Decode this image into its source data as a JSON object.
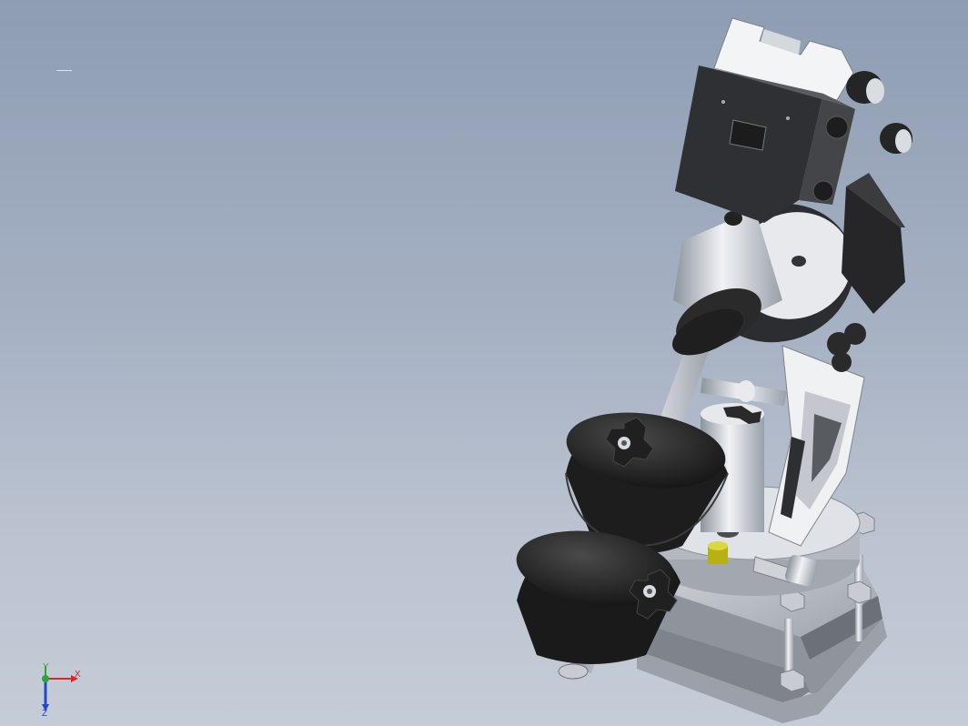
{
  "viewport": {
    "model_name": "equatorial-telescope-mount-assembly",
    "background_top": "#8e9db3",
    "background_bottom": "#c5ccd7"
  },
  "triad": {
    "x_label": "X",
    "y_label": "Y",
    "z_label": "Z",
    "x_color": "#d8262a",
    "y_color": "#2da43a",
    "z_color": "#2348c8"
  },
  "colors": {
    "metal_light": "#e8eaee",
    "metal_mid": "#b9bec7",
    "dark_part": "#2e2e2e",
    "accent_yellow": "#c9c31a"
  }
}
